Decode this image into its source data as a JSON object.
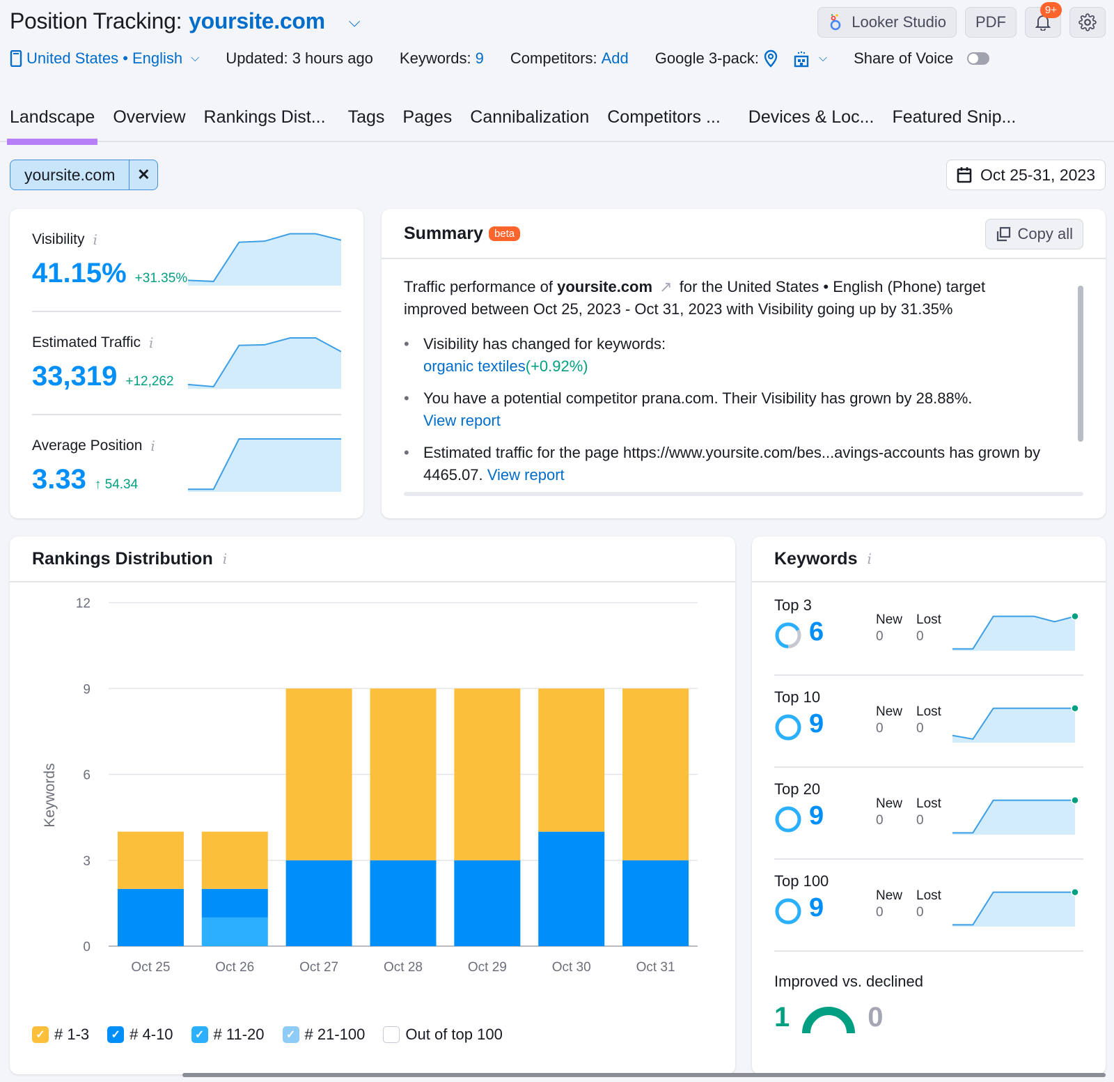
{
  "header": {
    "title_prefix": "Position Tracking:",
    "project": "yoursite.com",
    "buttons": {
      "looker": "Looker Studio",
      "pdf": "PDF",
      "notifications_badge": "9+"
    },
    "location": "United States • English",
    "updated": "Updated: 3 hours ago",
    "keywords_label": "Keywords:",
    "keywords_count": "9",
    "competitors_label": "Competitors:",
    "competitors_action": "Add",
    "google_pack_label": "Google 3-pack:",
    "share_of_voice": "Share of Voice",
    "share_of_voice_on": false
  },
  "tabs": [
    {
      "label": "Landscape",
      "active": true
    },
    {
      "label": "Overview"
    },
    {
      "label": "Rankings Dist..."
    },
    {
      "label": "Tags"
    },
    {
      "label": "Pages"
    },
    {
      "label": "Cannibalization"
    },
    {
      "label": "Competitors ..."
    },
    {
      "label": "Devices & Loc..."
    },
    {
      "label": "Featured Snip..."
    }
  ],
  "filter": {
    "chip": "yoursite.com",
    "date_range": "Oct 25-31, 2023"
  },
  "metrics": [
    {
      "label": "Visibility",
      "value": "41.15%",
      "delta": "+31.35%",
      "trend": [
        0.1,
        0.08,
        0.82,
        0.84,
        0.98,
        0.98,
        0.86
      ]
    },
    {
      "label": "Estimated Traffic",
      "value": "33,319",
      "delta": "+12,262",
      "trend": [
        0.08,
        0.04,
        0.82,
        0.83,
        0.96,
        0.96,
        0.7
      ]
    },
    {
      "label": "Average Position",
      "value": "3.33",
      "delta": "↑ 54.34",
      "trend": [
        0.05,
        0.05,
        1.0,
        1.0,
        1.0,
        1.0,
        1.0
      ]
    }
  ],
  "summary": {
    "title": "Summary",
    "badge": "beta",
    "copy_label": "Copy all",
    "intro_1": "Traffic performance of",
    "intro_site": "yoursite.com",
    "intro_2": "for the United States • English (Phone) target improved between Oct 25, 2023 - Oct 31, 2023 with Visibility going up by 31.35%",
    "bullets": {
      "b1_text": "Visibility has changed for keywords:",
      "b1_keyword": "organic textiles",
      "b1_delta": "(+0.92%)",
      "b2_text": "You have a potential competitor prana.com. Their Visibility has grown by 28.88%.",
      "b2_link": "View report",
      "b3_text": "Estimated traffic for the page https://www.yoursite.com/bes...avings-accounts has grown by 4465.07.",
      "b3_link": "View report"
    }
  },
  "rankings": {
    "title": "Rankings Distribution",
    "legend": [
      {
        "label": "# 1-3",
        "color": "#fbbf3c",
        "checked": true
      },
      {
        "label": "# 4-10",
        "color": "#008ff8",
        "checked": true
      },
      {
        "label": "# 11-20",
        "color": "#2bb0ff",
        "checked": true
      },
      {
        "label": "# 21-100",
        "color": "#8ecbf7",
        "checked": true
      },
      {
        "label": "Out of top 100",
        "color": "#ffffff",
        "checked": false
      }
    ]
  },
  "chart_data": {
    "type": "bar",
    "stacked": true,
    "title": "Rankings Distribution",
    "xlabel": "",
    "ylabel": "Keywords",
    "ylim": [
      0,
      12
    ],
    "yticks": [
      0,
      3,
      6,
      9,
      12
    ],
    "grid": true,
    "legend_position": "bottom-left",
    "categories": [
      "Oct 25",
      "Oct 26",
      "Oct 27",
      "Oct 28",
      "Oct 29",
      "Oct 30",
      "Oct 31"
    ],
    "series": [
      {
        "name": "# 11-20",
        "color": "#2bb0ff",
        "values": [
          0,
          1,
          0,
          0,
          0,
          0,
          0
        ]
      },
      {
        "name": "# 4-10",
        "color": "#008ff8",
        "values": [
          2,
          1,
          3,
          3,
          3,
          4,
          3
        ]
      },
      {
        "name": "# 1-3",
        "color": "#fbbf3c",
        "values": [
          2,
          2,
          6,
          6,
          6,
          5,
          6
        ]
      },
      {
        "name": "# 21-100",
        "color": "#8ecbf7",
        "values": [
          0,
          0,
          0,
          0,
          0,
          0,
          0
        ]
      }
    ]
  },
  "keywords": {
    "title": "Keywords",
    "new_label": "New",
    "lost_label": "Lost",
    "rows": [
      {
        "label": "Top 3",
        "value": "6",
        "share": 0.67,
        "new": "0",
        "lost": "0",
        "trend": [
          0.05,
          0.05,
          0.95,
          0.95,
          0.95,
          0.8,
          0.95
        ]
      },
      {
        "label": "Top 10",
        "value": "9",
        "share": 1.0,
        "new": "0",
        "lost": "0",
        "trend": [
          0.2,
          0.1,
          0.95,
          0.95,
          0.95,
          0.95,
          0.95
        ]
      },
      {
        "label": "Top 20",
        "value": "9",
        "share": 1.0,
        "new": "0",
        "lost": "0",
        "trend": [
          0.05,
          0.05,
          0.95,
          0.95,
          0.95,
          0.95,
          0.95
        ]
      },
      {
        "label": "Top 100",
        "value": "9",
        "share": 1.0,
        "new": "0",
        "lost": "0",
        "trend": [
          0.05,
          0.05,
          0.95,
          0.95,
          0.95,
          0.95,
          0.95
        ]
      }
    ],
    "improved_label": "Improved vs. declined",
    "improved": "1",
    "declined": "0"
  },
  "colors": {
    "accent_blue": "#008ff8",
    "link_blue": "#006dca",
    "positive_green": "#009f81",
    "tab_indicator": "#b67ef7",
    "badge_orange": "#ff642d"
  }
}
